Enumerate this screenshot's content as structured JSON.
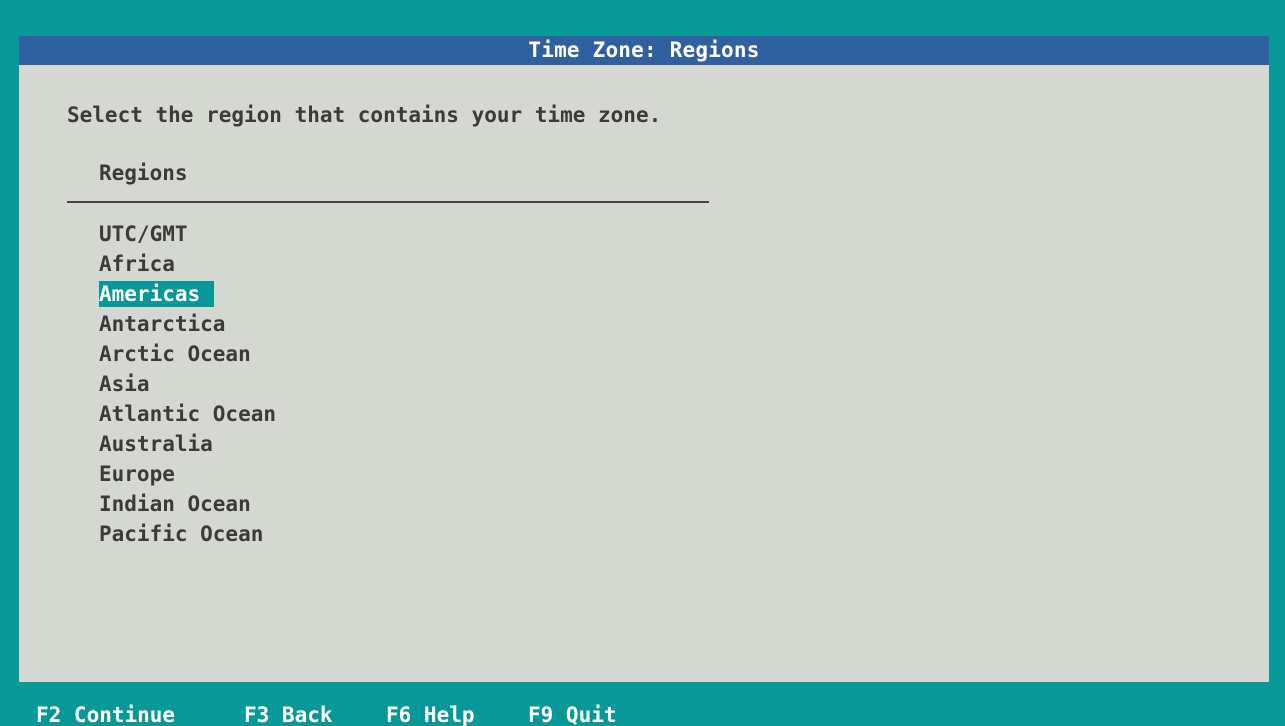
{
  "dialog": {
    "title": "Time Zone: Regions",
    "prompt": "Select the region that contains your time zone.",
    "list_header": "Regions",
    "regions": [
      {
        "label": "UTC/GMT",
        "selected": false
      },
      {
        "label": "Africa",
        "selected": false
      },
      {
        "label": "Americas",
        "selected": true
      },
      {
        "label": "Antarctica",
        "selected": false
      },
      {
        "label": "Arctic Ocean",
        "selected": false
      },
      {
        "label": "Asia",
        "selected": false
      },
      {
        "label": "Atlantic Ocean",
        "selected": false
      },
      {
        "label": "Australia",
        "selected": false
      },
      {
        "label": "Europe",
        "selected": false
      },
      {
        "label": "Indian Ocean",
        "selected": false
      },
      {
        "label": "Pacific Ocean",
        "selected": false
      }
    ]
  },
  "footer": {
    "continue": "F2 Continue",
    "back": "F3 Back",
    "help": "F6 Help",
    "quit": "F9 Quit"
  },
  "colors": {
    "background": "#089898",
    "panel": "#d4d8d0",
    "titlebar": "#3060a0",
    "highlight": "#089898",
    "text": "#3b3b3b"
  }
}
